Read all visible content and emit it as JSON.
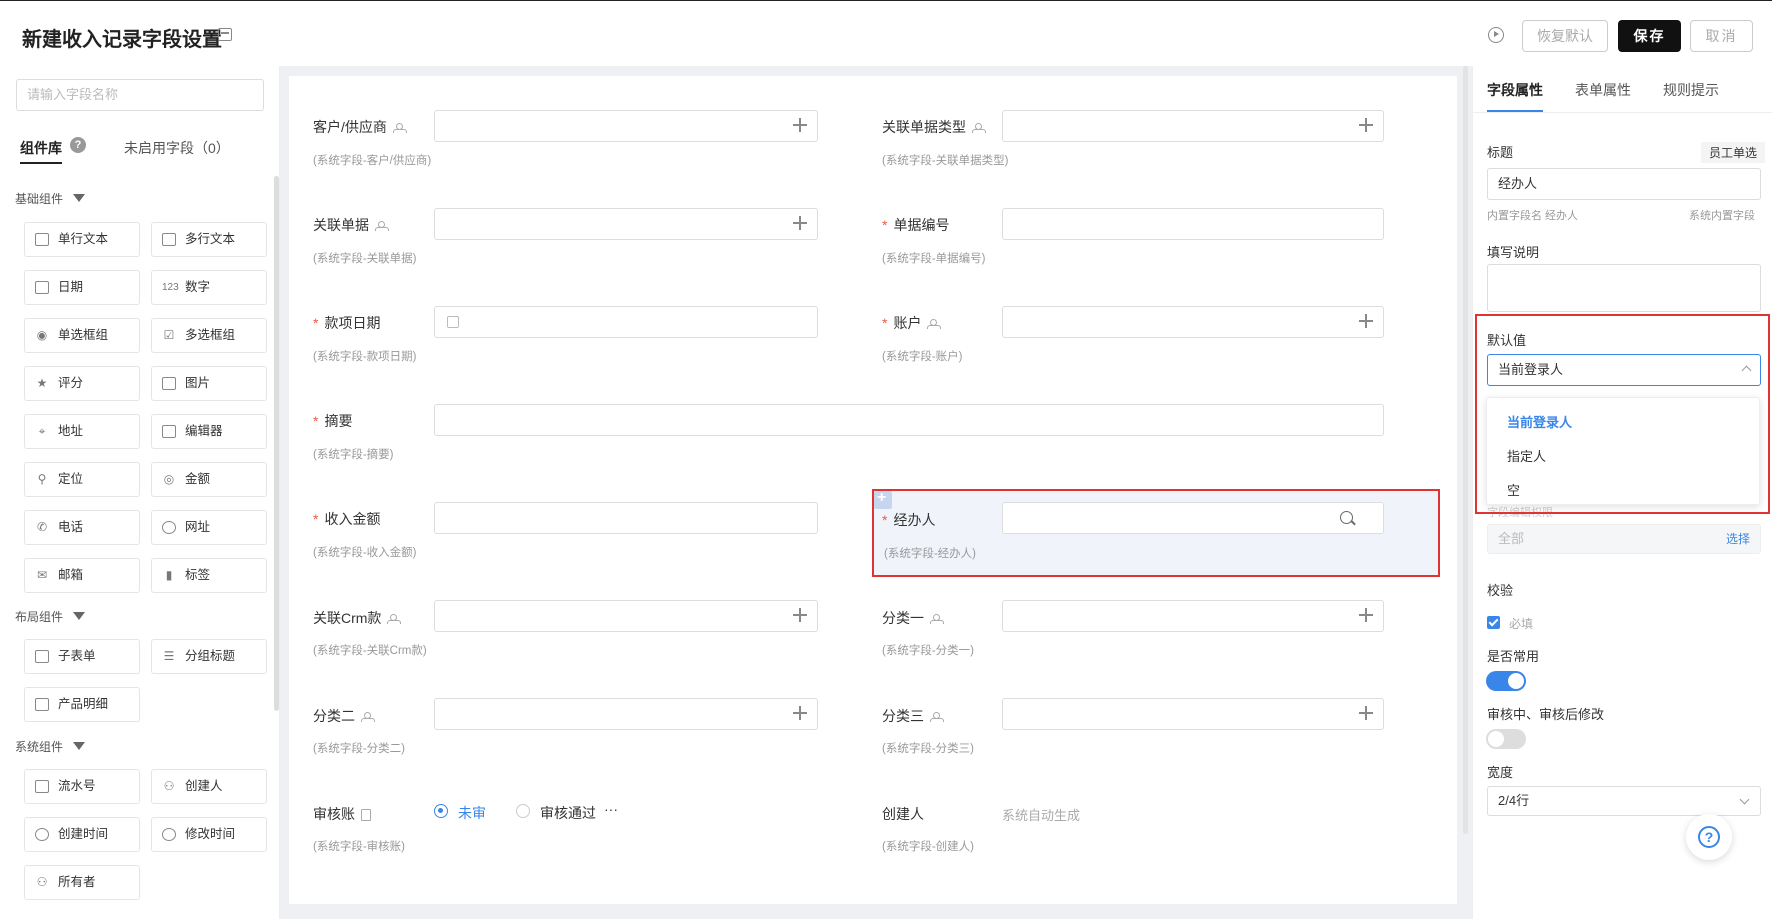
{
  "header": {
    "title": "新建收入记录字段设置",
    "restore_label": "恢复默认",
    "save_label": "保存",
    "cancel_label": "取消"
  },
  "left_panel": {
    "search_placeholder": "请输入字段名称",
    "tabs": {
      "library": "组件库",
      "unused": "未启用字段（0）"
    },
    "help_badge": "?",
    "sections": {
      "basic": "基础组件",
      "layout": "布局组件",
      "system": "系统组件"
    },
    "basic_components": [
      "单行文本",
      "多行文本",
      "日期",
      "数字",
      "单选框组",
      "多选框组",
      "评分",
      "图片",
      "地址",
      "编辑器",
      "定位",
      "金额",
      "电话",
      "网址",
      "邮箱",
      "标签"
    ],
    "layout_components": [
      "子表单",
      "分组标题",
      "产品明细"
    ],
    "system_components": [
      "流水号",
      "创建人",
      "创建时间",
      "修改时间",
      "所有者"
    ]
  },
  "form": {
    "fields": [
      {
        "label": "客户/供应商",
        "sub": "(系统字段-客户/供应商)"
      },
      {
        "label": "关联单据类型",
        "sub": "(系统字段-关联单据类型)"
      },
      {
        "label": "关联单据",
        "sub": "(系统字段-关联单据)"
      },
      {
        "label": "单据编号",
        "sub": "(系统字段-单据编号)"
      },
      {
        "label": "款项日期",
        "sub": "(系统字段-款项日期)"
      },
      {
        "label": "账户",
        "sub": "(系统字段-账户)"
      },
      {
        "label": "摘要",
        "sub": "(系统字段-摘要)"
      },
      {
        "label": "收入金额",
        "sub": "(系统字段-收入金额)"
      },
      {
        "label": "经办人",
        "sub": "(系统字段-经办人)"
      },
      {
        "label": "关联Crm款",
        "sub": "(系统字段-关联Crm款)"
      },
      {
        "label": "分类一",
        "sub": "(系统字段-分类一)"
      },
      {
        "label": "分类二",
        "sub": "(系统字段-分类二)"
      },
      {
        "label": "分类三",
        "sub": "(系统字段-分类三)"
      },
      {
        "label": "审核账",
        "sub": "(系统字段-审核账)"
      },
      {
        "label": "创建人",
        "sub": "(系统字段-创建人)"
      }
    ],
    "required_mark": "*",
    "audit_options": [
      "未审",
      "审核通过"
    ],
    "more": "···",
    "creator_value": "系统自动生成"
  },
  "right_panel": {
    "tabs": [
      "字段属性",
      "表单属性",
      "规则提示"
    ],
    "title_label": "标题",
    "title_type": "员工单选",
    "title_value": "经办人",
    "builtin_name": "内置字段名 经办人",
    "builtin_tag": "系统内置字段",
    "desc_label": "填写说明",
    "default_label": "默认值",
    "default_value": "当前登录人",
    "default_options": [
      "当前登录人",
      "指定人",
      "空"
    ],
    "hidden_label_fragment": "字段编辑权限",
    "range_value": "全部",
    "range_select": "选择",
    "validate_label": "校验",
    "required_label": "必填",
    "common_label": "是否常用",
    "audit_edit_label": "审核中、审核后修改",
    "width_label": "宽度",
    "width_value": "2/4行"
  },
  "colors": {
    "accent": "#3a86e8",
    "primary_button": "#111111",
    "highlight_border": "#e03333",
    "required": "#e85b4a"
  }
}
